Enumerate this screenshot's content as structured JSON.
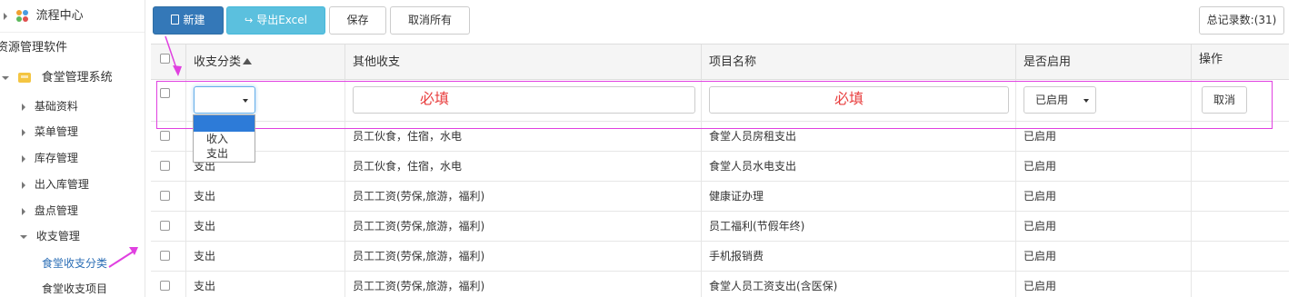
{
  "sidebar": {
    "flow_center": "流程中心",
    "software_root": "资源管理软件",
    "canteen_system": "食堂管理系统",
    "items": [
      {
        "label": "基础资料"
      },
      {
        "label": "菜单管理"
      },
      {
        "label": "库存管理"
      },
      {
        "label": "出入库管理"
      },
      {
        "label": "盘点管理"
      },
      {
        "label": "收支管理"
      }
    ],
    "sub_items": [
      {
        "label": "食堂收支分类"
      },
      {
        "label": "食堂收支项目"
      }
    ]
  },
  "toolbar": {
    "new_label": "新建",
    "export_label": "导出Excel",
    "save_label": "保存",
    "cancel_all_label": "取消所有",
    "total_records": "总记录数:(31)"
  },
  "grid": {
    "columns": [
      "收支分类",
      "其他收支",
      "项目名称",
      "是否启用",
      "操作"
    ],
    "edit_row": {
      "category_value": "",
      "other_placeholder": "必填",
      "name_placeholder": "必填",
      "enabled_value": "已启用",
      "cancel_label": "取消"
    },
    "dropdown_options": [
      "",
      "收入",
      "支出"
    ],
    "rows": [
      {
        "category": "",
        "other": "员工伙食，住宿，水电",
        "name": "食堂人员房租支出",
        "enabled": "已启用"
      },
      {
        "category": "支出",
        "other": "员工伙食，住宿，水电",
        "name": "食堂人员水电支出",
        "enabled": "已启用"
      },
      {
        "category": "支出",
        "other": "员工工资(劳保,旅游，福利)",
        "name": "健康证办理",
        "enabled": "已启用"
      },
      {
        "category": "支出",
        "other": "员工工资(劳保,旅游，福利)",
        "name": "员工福利(节假年终)",
        "enabled": "已启用"
      },
      {
        "category": "支出",
        "other": "员工工资(劳保,旅游，福利)",
        "name": "手机报销费",
        "enabled": "已启用"
      },
      {
        "category": "支出",
        "other": "员工工资(劳保,旅游，福利)",
        "name": "食堂人员工资支出(含医保)",
        "enabled": "已启用"
      }
    ]
  },
  "colors": {
    "primary": "#3478b8",
    "info": "#5bc0de",
    "annotation": "#e040e0",
    "required_text": "#e83e3e",
    "dropdown_selected": "#2d7bd8"
  }
}
